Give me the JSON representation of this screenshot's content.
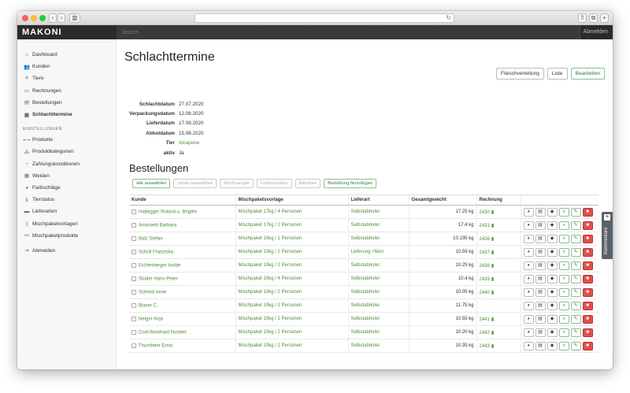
{
  "window": {
    "nav_icons": [
      "chevron-left-icon",
      "chevron-right-icon",
      "sidebar-icon",
      "share-icon",
      "tabs-icon"
    ]
  },
  "navbar": {
    "brand": "MAKONI",
    "search_placeholder": "Search",
    "logout": "Abmelden"
  },
  "sidebar": {
    "items": [
      {
        "label": "Dashboard",
        "icon": "home-icon",
        "glyph": "⌂"
      },
      {
        "label": "Kunden",
        "icon": "users-icon",
        "glyph": "👥"
      },
      {
        "label": "Tiere",
        "icon": "list-icon",
        "glyph": "≡"
      },
      {
        "label": "Rechnungen",
        "icon": "money-icon",
        "glyph": "▭"
      },
      {
        "label": "Bestellungen",
        "icon": "orders-icon",
        "glyph": "▤"
      },
      {
        "label": "Schlachttermine",
        "icon": "calendar-icon",
        "glyph": "▣",
        "active": true
      }
    ],
    "settings_heading": "EINSTELLUNGEN",
    "settings_items": [
      {
        "label": "Produkte",
        "icon": "product-icon",
        "glyph": "⟷"
      },
      {
        "label": "Produktkategorien",
        "icon": "categories-icon",
        "glyph": "⁂"
      },
      {
        "label": "Zahlungskonditionen",
        "icon": "payment-icon",
        "glyph": "◔"
      },
      {
        "label": "Weiden",
        "icon": "map-icon",
        "glyph": "▦"
      },
      {
        "label": "Farbschläge",
        "icon": "palette-icon",
        "glyph": "◕"
      },
      {
        "label": "Tierstatus",
        "icon": "info-icon",
        "glyph": "ℹ"
      },
      {
        "label": "Lieferarten",
        "icon": "truck-icon",
        "glyph": "▬"
      },
      {
        "label": "Mischpaketvorlagen",
        "icon": "file-icon",
        "glyph": "▯"
      },
      {
        "label": "Mischpaketprodukte",
        "icon": "link-icon",
        "glyph": "⚯"
      }
    ],
    "logout": {
      "label": "Abmelden",
      "icon": "logout-icon",
      "glyph": "⇥"
    }
  },
  "page": {
    "title": "Schlachttermine",
    "actions": [
      {
        "label": "Fleischverteilung",
        "style": "default"
      },
      {
        "label": "Liste",
        "style": "default"
      },
      {
        "label": "Bearbeiten",
        "style": "success"
      }
    ],
    "details": [
      {
        "label": "Schlachtdatum",
        "value": "27.07.2020",
        "link": false
      },
      {
        "label": "Verpackungsdatum",
        "value": "12.08.2020",
        "link": false
      },
      {
        "label": "Lieferdatum",
        "value": "17.08.2020",
        "link": false
      },
      {
        "label": "Abholdatum",
        "value": "15.08.2020",
        "link": false
      },
      {
        "label": "Tier",
        "value": "Alcapone",
        "link": true
      },
      {
        "label": "aktiv",
        "value": "Ja",
        "link": false
      }
    ]
  },
  "orders": {
    "title": "Bestellungen",
    "bulk_buttons": [
      {
        "label": "alle auswählen",
        "enabled": true
      },
      {
        "label": "nichte auswählen",
        "enabled": false
      },
      {
        "label": "Rechnungen",
        "enabled": false
      },
      {
        "label": "Lieferscheine",
        "enabled": false
      },
      {
        "label": "Etiketten",
        "enabled": false
      },
      {
        "label": "Bestellung hinzufügen",
        "enabled": true
      }
    ],
    "columns": [
      "Kunde",
      "Mischpaketsvorlage",
      "Lieferart",
      "Gesamtgewicht",
      "Rechnung"
    ],
    "rows": [
      {
        "kunde": "Habegger Roland u. Brigitte",
        "vorlage": "Mischpaket 17kg / 4 Personen",
        "lieferart": "Selbstabholer",
        "gewicht": "17.25 kg",
        "rechnung": "2430"
      },
      {
        "kunde": "Antonietti Barbara",
        "vorlage": "Mischpaket 17kg / 2 Personen",
        "lieferart": "Selbstabholer",
        "gewicht": "17.4 kg",
        "rechnung": "2431"
      },
      {
        "kunde": "Balz Stefan",
        "vorlage": "Mischpaket 10kg / 2 Personen",
        "lieferart": "Selbstabholer",
        "gewicht": "10.195 kg",
        "rechnung": "2436"
      },
      {
        "kunde": "Scholl Franziska",
        "vorlage": "Mischpaket 10kg / 2 Personen",
        "lieferart": "Lieferung >5km",
        "gewicht": "10.59 kg",
        "rechnung": "2437"
      },
      {
        "kunde": "Eichenberger Isolde",
        "vorlage": "Mischpaket 10kg / 2 Personen",
        "lieferart": "Selbstabholer",
        "gewicht": "10.25 kg",
        "rechnung": "2438"
      },
      {
        "kunde": "Studer Hans-Peter",
        "vorlage": "Mischpaket 10kg / 4 Personen",
        "lieferart": "Selbstabholer",
        "gewicht": "10.4 kg",
        "rechnung": "2439"
      },
      {
        "kunde": "Schmid Irene",
        "vorlage": "Mischpaket 10kg / 2 Personen",
        "lieferart": "Selbstabholer",
        "gewicht": "10.05 kg",
        "rechnung": "2440"
      },
      {
        "kunde": "Blaser C.",
        "vorlage": "Mischpaket 10kg / 2 Personen",
        "lieferart": "Selbstabholer",
        "gewicht": "11.75 kg",
        "rechnung": ""
      },
      {
        "kunde": "Neiger Anja",
        "vorlage": "Mischpaket 10kg / 2 Personen",
        "lieferart": "Selbstabholer",
        "gewicht": "10.55 kg",
        "rechnung": "2441"
      },
      {
        "kunde": "Corti-Reinhard Norbert",
        "vorlage": "Mischpaket 10kg / 2 Personen",
        "lieferart": "Selbstabholer",
        "gewicht": "10.20 kg",
        "rechnung": "2442"
      },
      {
        "kunde": "Thurnheer Ernst",
        "vorlage": "Mischpaket 10kg / 2 Personen",
        "lieferart": "Selbstabholer",
        "gewicht": "10.35 kg",
        "rechnung": "2443"
      }
    ],
    "row_actions": [
      {
        "name": "pie-chart-icon",
        "glyph": "◕",
        "style": "default"
      },
      {
        "name": "list-icon",
        "glyph": "▤",
        "style": "default"
      },
      {
        "name": "tag-icon",
        "glyph": "◆",
        "style": "default"
      },
      {
        "name": "search-icon",
        "glyph": "⌕",
        "style": "g"
      },
      {
        "name": "pencil-icon",
        "glyph": "✎",
        "style": "g"
      },
      {
        "name": "trash-icon",
        "glyph": "■",
        "style": "red"
      }
    ]
  },
  "comments_tab": {
    "label": "Kommentare"
  },
  "colors": {
    "accent_green": "#4e8d3a",
    "navbar": "#2b2b2b",
    "danger": "#d9534f"
  }
}
